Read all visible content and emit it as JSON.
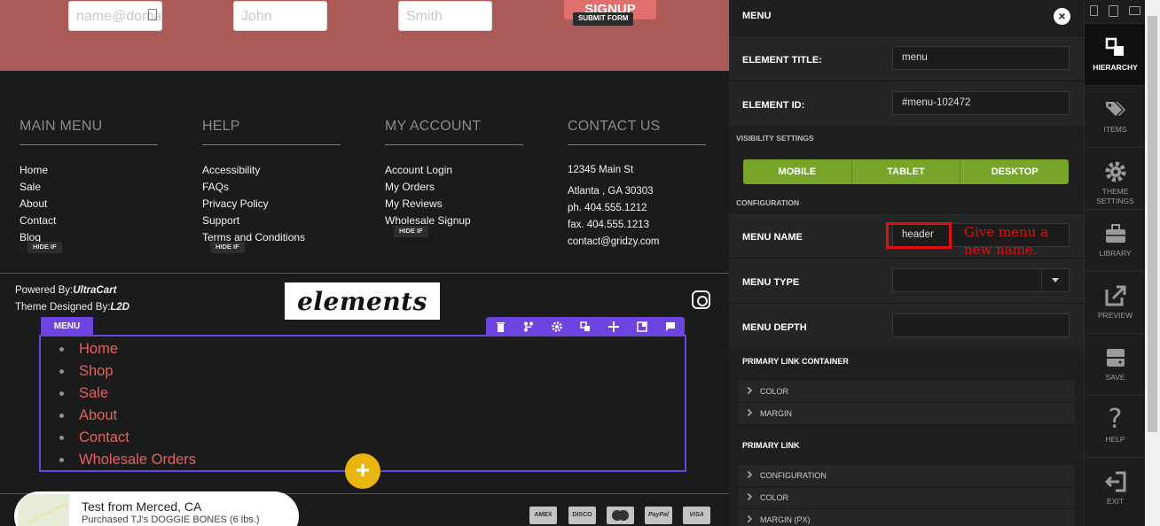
{
  "signup": {
    "email_placeholder": "name@domain.com",
    "first_placeholder": "John",
    "last_placeholder": "Smith",
    "signup_label": "SIGNUP",
    "submit_tag": "SUBMIT FORM"
  },
  "footer": {
    "columns": [
      {
        "heading": "MAIN MENU",
        "links": [
          "Home",
          "Sale",
          "About",
          "Contact",
          "Blog"
        ]
      },
      {
        "heading": "HELP",
        "links": [
          "Accessibility",
          "FAQs",
          "Privacy Policy",
          "Support",
          "Terms and Conditions"
        ]
      },
      {
        "heading": "MY ACCOUNT",
        "links": [
          "Account Login",
          "My Orders",
          "My Reviews",
          "Wholesale Signup"
        ]
      },
      {
        "heading": "CONTACT US",
        "lines": [
          "12345 Main St",
          "Atlanta , GA  30303",
          "ph. 404.555.1212",
          "fax. 404.555.1213",
          "contact@gridzy.com"
        ]
      }
    ],
    "hide_if": "HIDE IF",
    "powered_by_label": "Powered By:",
    "powered_by_value": "UltraCart",
    "theme_label": "Theme Designed By:",
    "theme_value": "L2D",
    "logo_text": "elements"
  },
  "menu_element": {
    "tag": "MENU",
    "items": [
      "Home",
      "Shop",
      "Sale",
      "About",
      "Contact",
      "Wholesale Orders"
    ],
    "toolbar_icons": [
      "trash-icon",
      "branch-icon",
      "gear-icon",
      "copy-icon",
      "plus-icon",
      "layout-icon",
      "comment-icon"
    ]
  },
  "toast": {
    "title": "Test from Merced, CA",
    "subtitle": "Purchased TJ's DOGGIE BONES (6 lbs.)"
  },
  "payments": [
    "AMEX",
    "DISCO",
    "MC",
    "PayPal",
    "VISA"
  ],
  "panel": {
    "title": "MENU",
    "element_title_label": "ELEMENT TITLE:",
    "element_title_value": "menu",
    "element_id_label": "ELEMENT ID:",
    "element_id_value": "#menu-102472",
    "visibility_label": "VISIBILITY SETTINGS",
    "visibility": [
      "MOBILE",
      "TABLET",
      "DESKTOP"
    ],
    "configuration_label": "CONFIGURATION",
    "menu_name_label": "MENU NAME",
    "menu_name_value": "header",
    "menu_type_label": "MENU TYPE",
    "menu_type_value": "",
    "menu_depth_label": "MENU DEPTH",
    "menu_depth_value": "",
    "primary_link_container": "PRIMARY LINK CONTAINER",
    "plc_items": [
      "COLOR",
      "MARGIN"
    ],
    "primary_link": "PRIMARY LINK",
    "pl_items": [
      "CONFIGURATION",
      "COLOR",
      "MARGIN (PX)"
    ],
    "annotation": "Give menu a new name."
  },
  "rail": {
    "items": [
      {
        "label": "HIERARCHY",
        "icon": "hierarchy-icon",
        "active": true
      },
      {
        "label": "ITEMS",
        "icon": "tags-icon",
        "active": false
      },
      {
        "label": "THEME SETTINGS",
        "icon": "gear-icon",
        "active": false
      },
      {
        "label": "LIBRARY",
        "icon": "briefcase-icon",
        "active": false
      },
      {
        "label": "PREVIEW",
        "icon": "external-link-icon",
        "active": false
      },
      {
        "label": "SAVE",
        "icon": "save-icon",
        "active": false
      },
      {
        "label": "HELP",
        "icon": "question-icon",
        "active": false
      },
      {
        "label": "EXIT",
        "icon": "exit-icon",
        "active": false
      }
    ]
  },
  "colors": {
    "accent_purple": "#6c45e0",
    "visibility_green": "#76a52a",
    "link_red": "#e4625e",
    "signup_band": "#ac5a58",
    "annotation_red": "#e01010"
  }
}
